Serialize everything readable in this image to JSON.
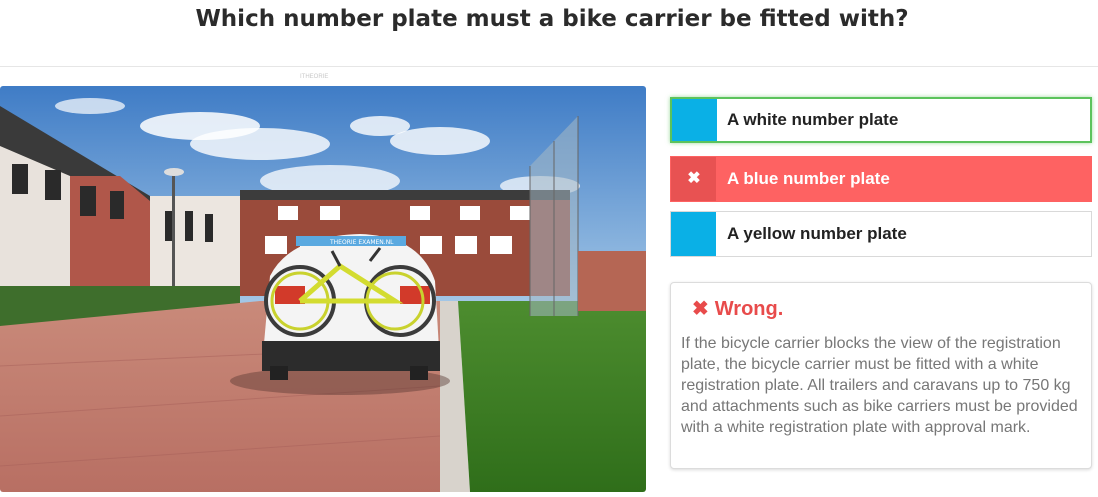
{
  "question": {
    "title": "Which number plate must a bike carrier be fitted with?"
  },
  "watermark": "ITHEORIE",
  "scene": {
    "alt_label": "Car with bike carrier and yellow bicycle",
    "sign_text": "THEORIE EXAMEN.NL"
  },
  "options": [
    {
      "label": "A white number plate",
      "state": "correct-answer",
      "marker_icon": "blue-square-icon"
    },
    {
      "label": "A blue number plate",
      "state": "selected-wrong",
      "marker_icon": "close-icon",
      "marker_glyph": "✖"
    },
    {
      "label": "A yellow number plate",
      "state": "default",
      "marker_icon": "blue-square-icon"
    }
  ],
  "feedback": {
    "icon_glyph": "✖",
    "heading": "Wrong.",
    "text": "If the bicycle carrier blocks the view of the registration plate, the bicycle carrier must be fitted with a white registration plate. All trailers and caravans up to 750 kg and attachments such as bike carriers must be provided with a white registration plate with approval mark."
  },
  "colors": {
    "correct_border": "#5cc35c",
    "wrong_bg": "#fe6262",
    "marker_blue": "#0ab0e6",
    "feedback_red": "#e84b4b"
  }
}
